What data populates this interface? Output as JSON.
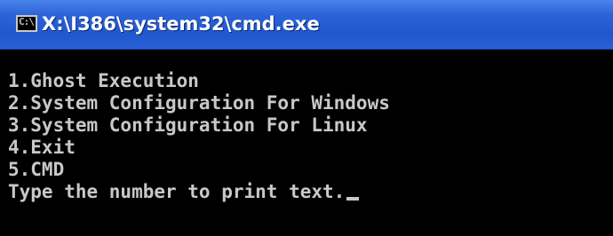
{
  "window": {
    "title": "X:\\I386\\system32\\cmd.exe",
    "icon": "cmd-window-icon",
    "icon_glyph": "C:\\"
  },
  "console": {
    "menu_items": [
      "1.Ghost Execution",
      "2.System Configuration For Windows",
      "3.System Configuration For Linux",
      "4.Exit",
      "5.CMD"
    ],
    "prompt": "Type the number to print text."
  },
  "colors": {
    "console_background": "#000000",
    "console_text": "#c8c8c8",
    "titlebar": "#2c63d8"
  }
}
